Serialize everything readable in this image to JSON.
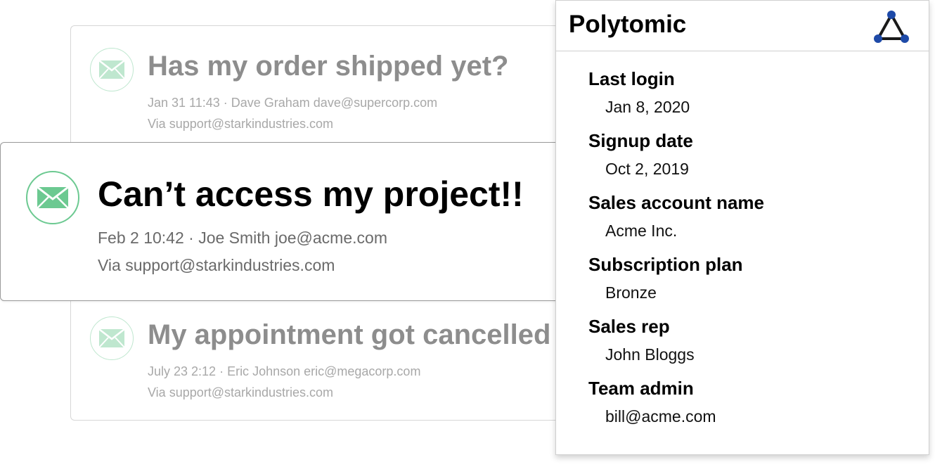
{
  "tickets": {
    "previous": {
      "title": "Has my order shipped yet?",
      "meta": "Jan 31 11:43 · Dave Graham dave@supercorp.com",
      "via": "Via support@starkindustries.com",
      "icon": "envelope-icon"
    },
    "active": {
      "title": "Can’t access my project!!",
      "meta": "Feb 2 10:42 · Joe Smith joe@acme.com",
      "via": "Via support@starkindustries.com",
      "icon": "envelope-icon"
    },
    "next": {
      "title": "My appointment got cancelled",
      "meta": "July 23 2:12 · Eric Johnson eric@megacorp.com",
      "via": "Via support@starkindustries.com",
      "icon": "envelope-icon"
    }
  },
  "panel": {
    "title": "Polytomic",
    "logo_icon": "polytomic-triangle-logo",
    "fields": [
      {
        "label": "Last login",
        "value": "Jan 8, 2020"
      },
      {
        "label": "Signup date",
        "value": "Oct 2, 2019"
      },
      {
        "label": "Sales account name",
        "value": "Acme Inc."
      },
      {
        "label": "Subscription plan",
        "value": "Bronze"
      },
      {
        "label": "Sales rep",
        "value": "John Bloggs"
      },
      {
        "label": "Team admin",
        "value": "bill@acme.com"
      }
    ]
  },
  "colors": {
    "envelope_green": "#6cc991",
    "envelope_green_faded": "#bfe7cf",
    "logo_blue": "#1e4aa8",
    "logo_stroke": "#1a1a1a"
  }
}
